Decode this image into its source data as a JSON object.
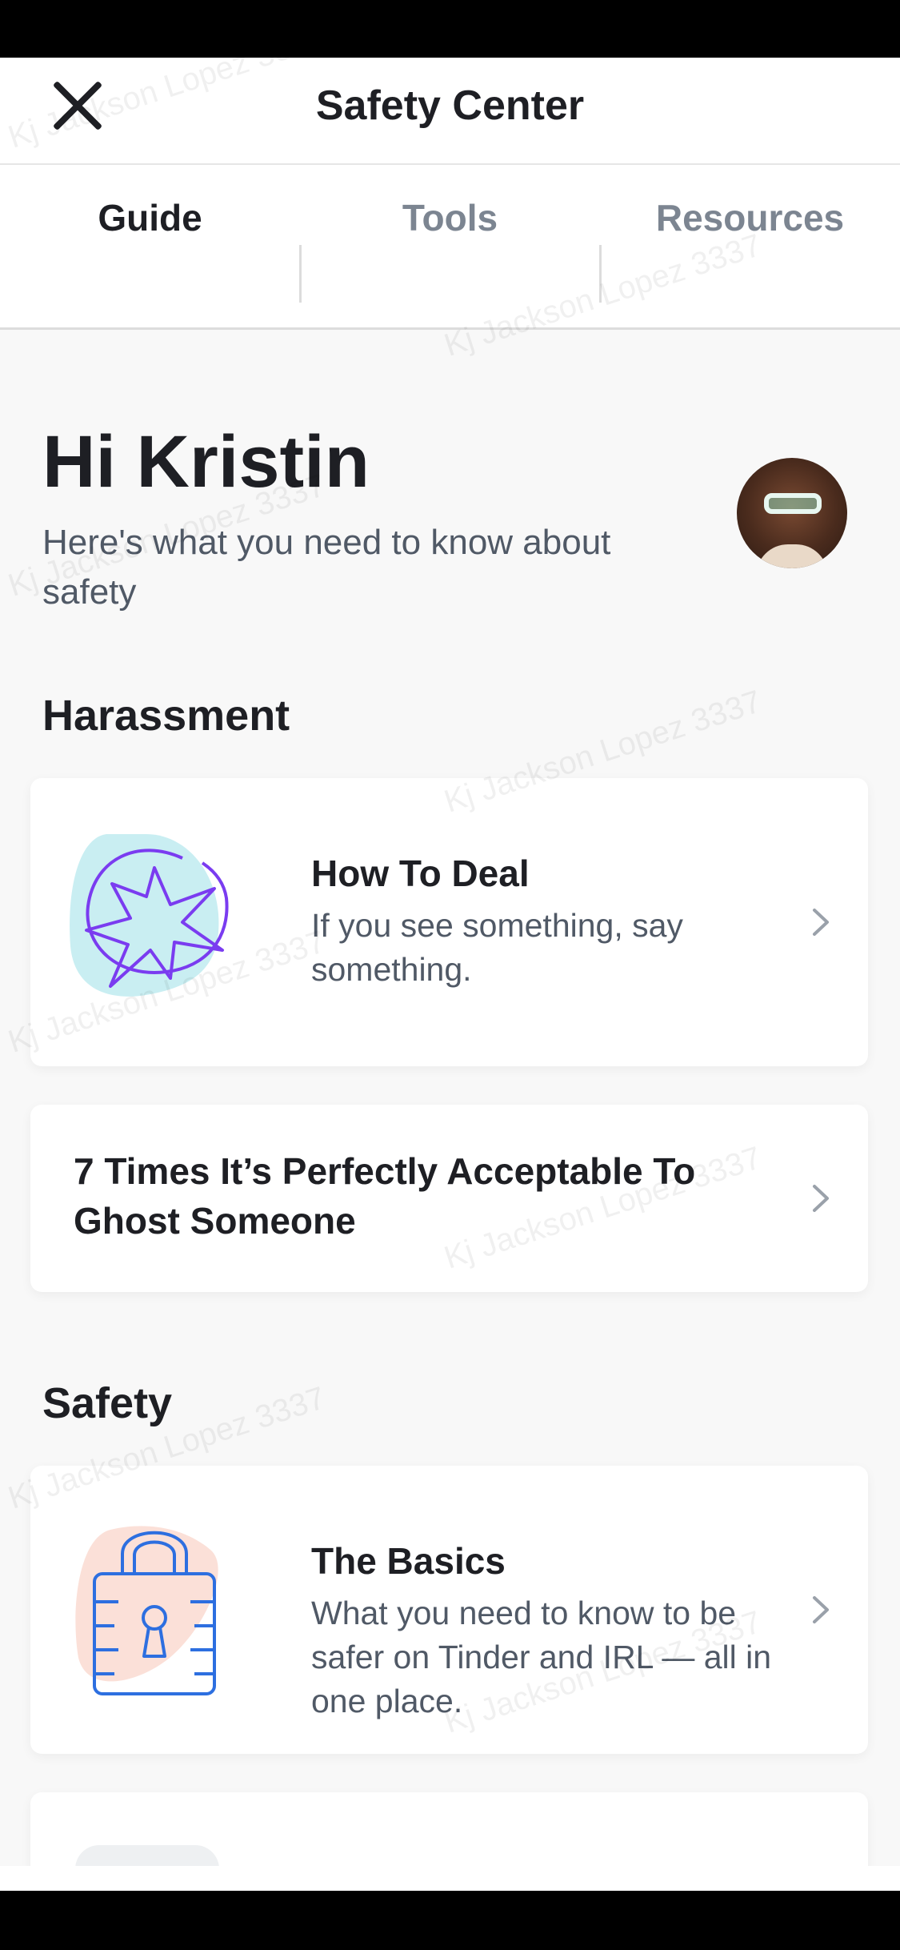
{
  "header": {
    "title": "Safety Center"
  },
  "tabs": [
    {
      "label": "Guide",
      "active": true
    },
    {
      "label": "Tools",
      "active": false
    },
    {
      "label": "Resources",
      "active": false
    }
  ],
  "greeting": {
    "title": "Hi Kristin",
    "subtitle": "Here's what you need to know about safety"
  },
  "sections": [
    {
      "title": "Harassment",
      "cards": [
        {
          "heading": "How To Deal",
          "description": "If you see something, say something.",
          "icon": "speech-burst-icon"
        },
        {
          "heading": "7 Times It’s Perfectly Acceptable To Ghost Someone"
        }
      ]
    },
    {
      "title": "Safety",
      "cards": [
        {
          "heading": "The Basics",
          "description": "What you need to know to be safer on Tinder and IRL — all in one place.",
          "icon": "padlock-icon"
        }
      ]
    }
  ],
  "watermark": "Kj Jackson Lopez 3337",
  "colors": {
    "text": "#1e1f24",
    "muted": "#505966",
    "tab_inactive": "#7c8591",
    "accent_purple": "#7a3cf0",
    "accent_blue": "#2d6fe0",
    "accent_teal": "#c9eef2",
    "accent_pink": "#fbe0d8"
  }
}
